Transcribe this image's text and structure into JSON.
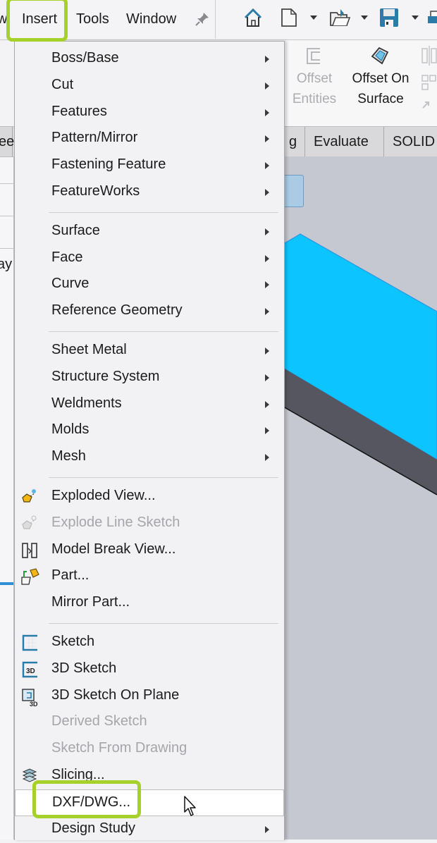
{
  "menubar": {
    "items": [
      "w",
      "Insert",
      "Tools",
      "Window"
    ],
    "pin_icon": "pin-icon",
    "toolbar_icons": [
      "home-icon",
      "new-document-icon",
      "open-folder-icon",
      "save-icon",
      "print-icon"
    ]
  },
  "ribbon": {
    "offset_entities": "Offset\nEntities",
    "offset_entities_line1": "Offset",
    "offset_entities_line2": "Entities",
    "offset_on_surface_line1": "Offset On",
    "offset_on_surface_line2": "Surface"
  },
  "tabs": [
    "ee",
    "g",
    "Evaluate",
    "SOLID"
  ],
  "left_panel": {
    "partial_text": "ay"
  },
  "insert_menu": {
    "groups": [
      [
        {
          "label": "Boss/Base",
          "submenu": true
        },
        {
          "label": "Cut",
          "submenu": true
        },
        {
          "label": "Features",
          "submenu": true
        },
        {
          "label": "Pattern/Mirror",
          "submenu": true
        },
        {
          "label": "Fastening Feature",
          "submenu": true
        },
        {
          "label": "FeatureWorks",
          "submenu": true
        }
      ],
      [
        {
          "label": "Surface",
          "submenu": true
        },
        {
          "label": "Face",
          "submenu": true
        },
        {
          "label": "Curve",
          "submenu": true
        },
        {
          "label": "Reference Geometry",
          "submenu": true
        }
      ],
      [
        {
          "label": "Sheet Metal",
          "submenu": true
        },
        {
          "label": "Structure System",
          "submenu": true
        },
        {
          "label": "Weldments",
          "submenu": true
        },
        {
          "label": "Molds",
          "submenu": true
        },
        {
          "label": "Mesh",
          "submenu": true
        }
      ],
      [
        {
          "label": "Exploded View...",
          "icon": "exploded-view-icon"
        },
        {
          "label": "Explode Line Sketch",
          "icon": "explode-line-sketch-icon",
          "disabled": true
        },
        {
          "label": "Model Break View...",
          "icon": "model-break-view-icon"
        },
        {
          "label": "Part...",
          "icon": "insert-part-icon"
        },
        {
          "label": "Mirror Part..."
        }
      ],
      [
        {
          "label": "Sketch",
          "icon": "sketch-icon"
        },
        {
          "label": "3D Sketch",
          "icon": "3d-sketch-icon"
        },
        {
          "label": "3D Sketch On Plane",
          "icon": "3d-sketch-on-plane-icon"
        },
        {
          "label": "Derived Sketch",
          "disabled": true
        },
        {
          "label": "Sketch From Drawing",
          "disabled": true
        },
        {
          "label": "Slicing...",
          "icon": "slicing-icon"
        },
        {
          "label": "DXF/DWG...",
          "hovered": true,
          "highlighted": true
        },
        {
          "label": "Design Study",
          "submenu": true
        }
      ]
    ]
  },
  "colors": {
    "highlight": "#a6d12a",
    "model_face": "#0cc4ff",
    "model_side": "#55565f",
    "viewport_bg": "#c5c7d1"
  }
}
